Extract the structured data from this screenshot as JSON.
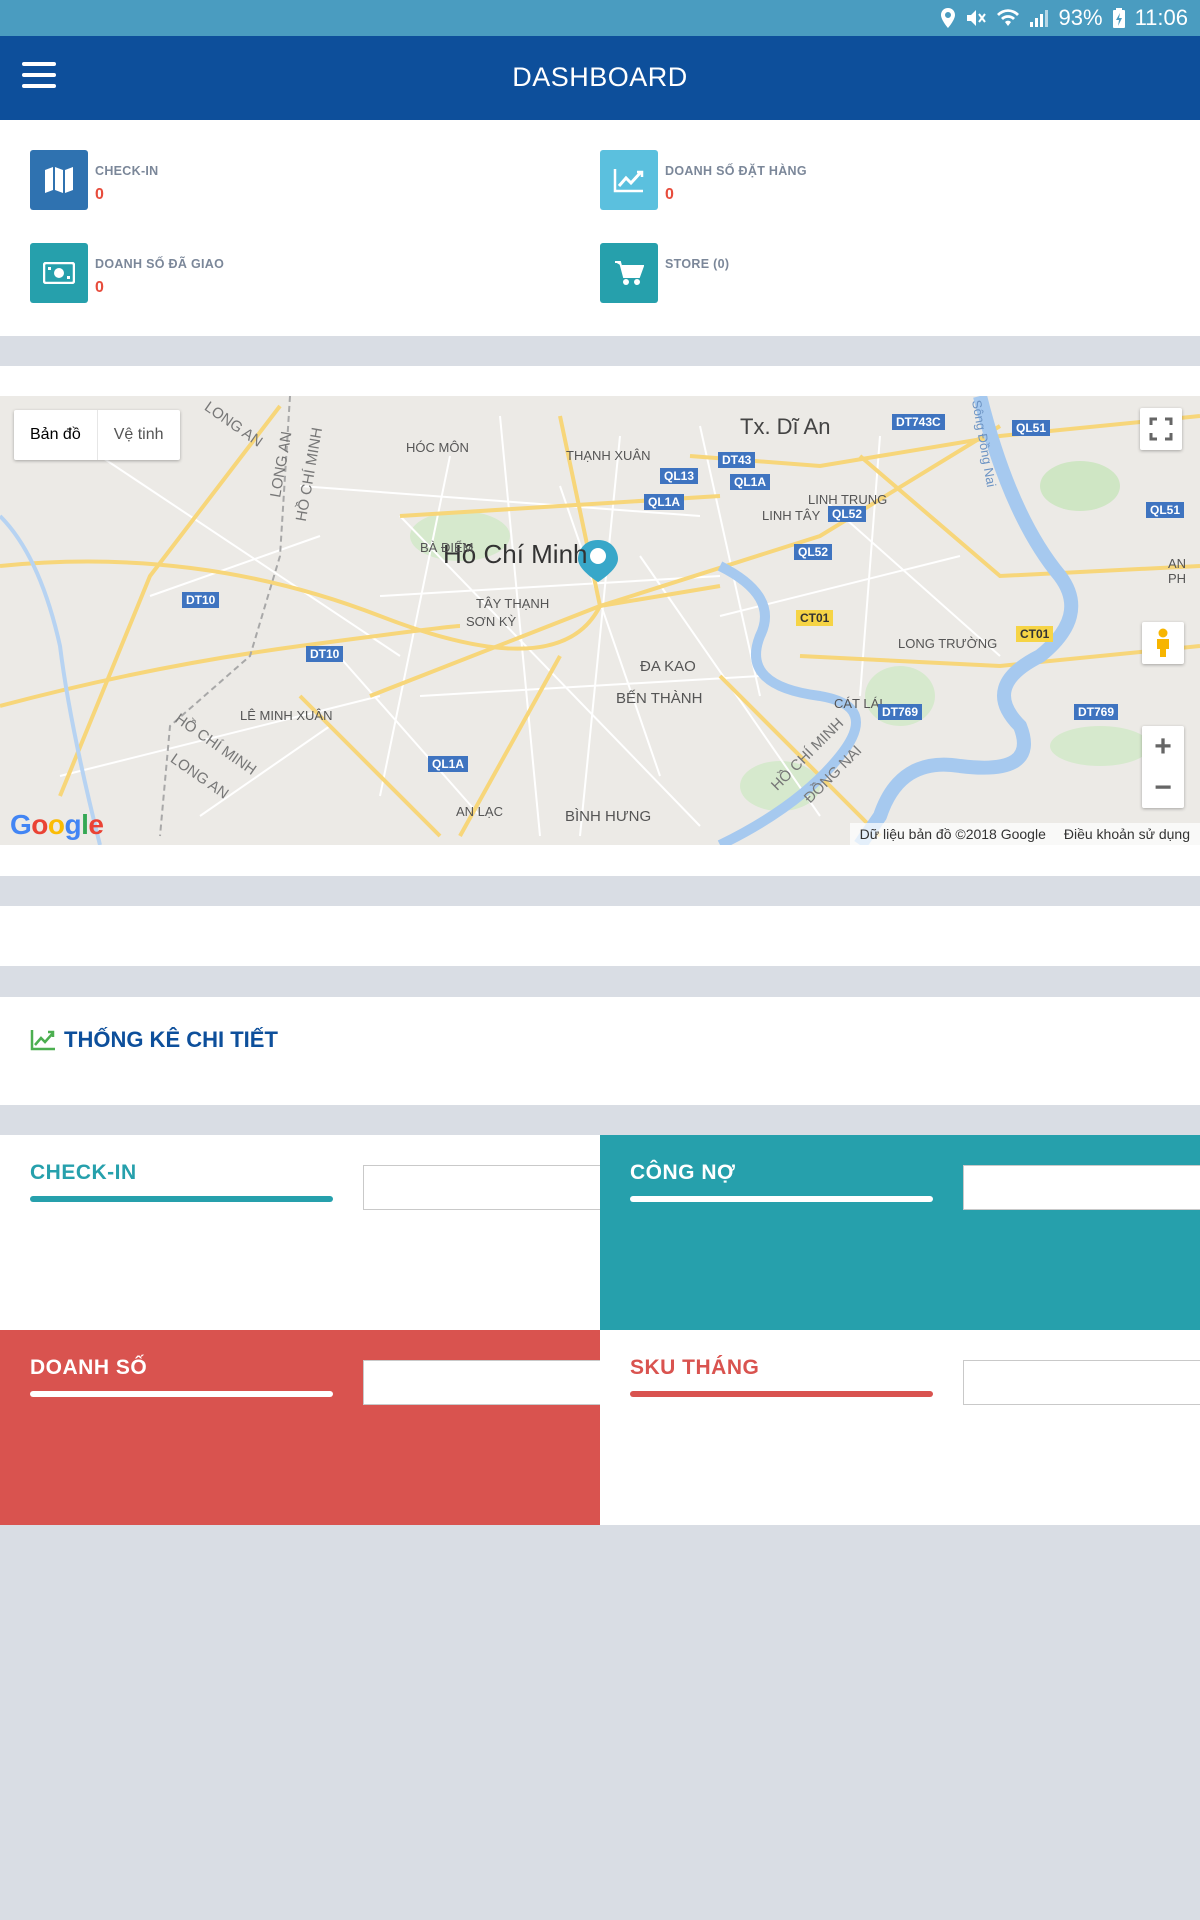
{
  "status_bar": {
    "battery": "93%",
    "time": "11:06"
  },
  "header": {
    "title": "DASHBOARD"
  },
  "stats": [
    {
      "label": "CHECK-IN",
      "value": "0",
      "icon": "map-icon",
      "color": "#2f72b0"
    },
    {
      "label": "DOANH SỐ ĐẶT HÀNG",
      "value": "0",
      "icon": "line-chart-icon",
      "color": "#5bc0de"
    },
    {
      "label": "DOANH SỐ ĐÃ GIAO",
      "value": "0",
      "icon": "money-icon",
      "color": "#26a0ac"
    },
    {
      "label": "STORE (0)",
      "value": "",
      "icon": "cart-icon",
      "color": "#26a0ac"
    }
  ],
  "map": {
    "type_buttons": [
      "Bản đồ",
      "Vệ tinh"
    ],
    "logo": "Google",
    "attribution": "Dữ liệu bản đồ ©2018 Google",
    "terms": "Điều khoản sử dụng",
    "zoom_in": "+",
    "zoom_out": "−",
    "labels": {
      "city": "Hồ Chí Minh",
      "di_an": "Tx. Dĩ An",
      "hoc_mon": "HÓC MÔN",
      "thanh_xuan": "THẠNH XUÂN",
      "linh_trung": "LINH TRUNG",
      "linh_tay": "LINH TÂY",
      "ba_diem": "BÀ ĐIỂM",
      "tay_thanh": "TÂY THẠNH",
      "son_ky": "SƠN KỲ",
      "da_kao": "ĐA KAO",
      "ben_thanh": "BẾN THÀNH",
      "cat_lai": "CÁT LÁI",
      "long_truong": "LONG TRƯỜNG",
      "le_minh_xuan": "LÊ MINH XUÂN",
      "an_lac": "AN LẠC",
      "binh_hung": "BÌNH HƯNG",
      "an_phu": "AN PH",
      "long_an_1": "LONG AN",
      "long_an_2": "LONG AN",
      "long_an_3": "LONG AN",
      "hcm_1": "HỒ CHÍ MINH",
      "hcm_2": "HỒ CHÍ MINH",
      "hcm_3": "HỒ CHÍ MINH",
      "dong_nai": "ĐỒNG NAI",
      "song_dong_nai": "Sông Đồng Nai"
    },
    "shields": {
      "dt743c": "DT743C",
      "ql51a": "QL51",
      "ql51b": "QL51",
      "dt43": "DT43",
      "ql13": "QL13",
      "ql1a_1": "QL1A",
      "ql1a_2": "QL1A",
      "ql1a_3": "QL1A",
      "ql52a": "QL52",
      "ql52b": "QL52",
      "dt10a": "DT10",
      "dt10b": "DT10",
      "ct01a": "CT01",
      "ct01b": "CT01",
      "dt769a": "DT769",
      "dt769b": "DT769"
    }
  },
  "section": {
    "title": "THỐNG KÊ CHI TIẾT"
  },
  "tiles": [
    {
      "title": "CHECK-IN",
      "bg": "#ffffff",
      "fg": "#26a0ac"
    },
    {
      "title": "CÔNG NỢ",
      "bg": "#26a0ac",
      "fg": "#ffffff"
    },
    {
      "title": "DOANH SỐ",
      "bg": "#d9534f",
      "fg": "#ffffff"
    },
    {
      "title": "SKU THÁNG",
      "bg": "#ffffff",
      "fg": "#d9534f"
    }
  ]
}
